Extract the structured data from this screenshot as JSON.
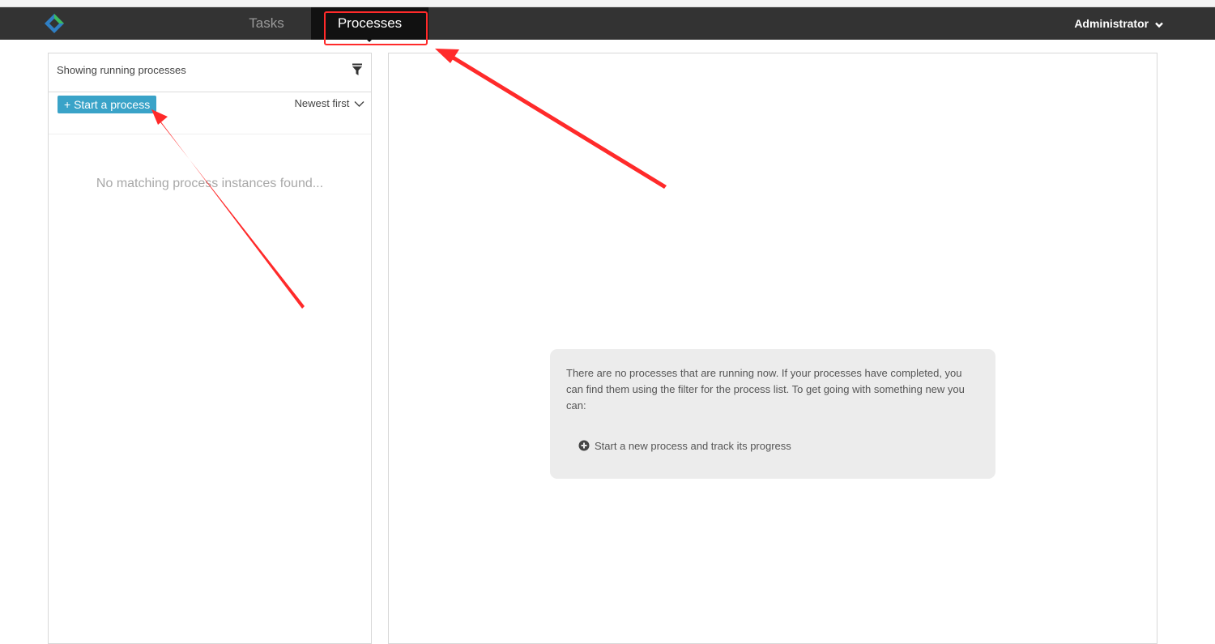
{
  "nav": {
    "tabs": [
      {
        "label": "Tasks",
        "active": false
      },
      {
        "label": "Processes",
        "active": true
      }
    ],
    "user_label": "Administrator"
  },
  "left_panel": {
    "title": "Showing running processes",
    "start_button": "+ Start a process",
    "sort_label": "Newest first",
    "empty_message": "No matching process instances found..."
  },
  "right_panel": {
    "help_text": "There are no processes that are running now. If your processes have completed, you can find them using the filter for the process list. To get going with something new you can:",
    "help_action": "Start a new process and track its progress"
  },
  "colors": {
    "navbar": "#333333",
    "active_tab": "#111111",
    "primary_button": "#3aa3c8",
    "annotation": "#ff2a2a",
    "logo_blue": "#2f7fc4",
    "logo_green": "#3dbb5e"
  }
}
